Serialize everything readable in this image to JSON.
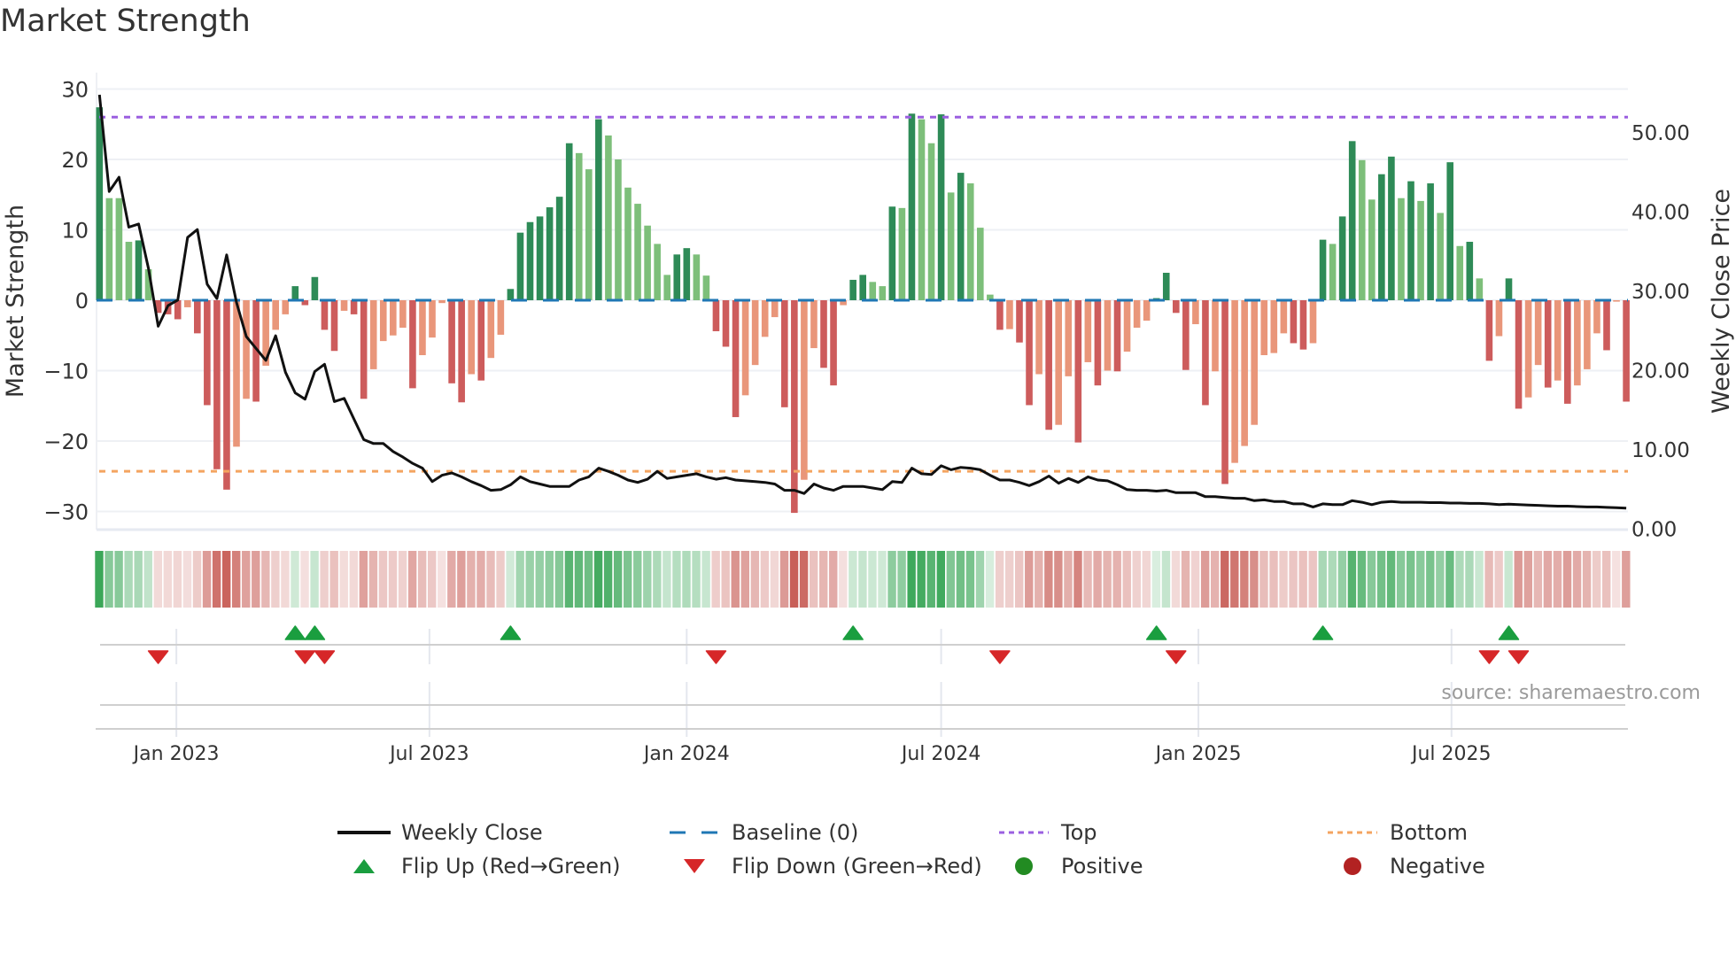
{
  "title": "Market Strength",
  "source": "source: sharemaestro.com",
  "legend": {
    "weekly_close": "Weekly Close",
    "baseline": "Baseline (0)",
    "top": "Top",
    "bottom": "Bottom",
    "flip_up": "Flip Up (Red→Green)",
    "flip_down": "Flip Down (Green→Red)",
    "positive": "Positive",
    "negative": "Negative"
  },
  "colors": {
    "bar_pos_strong": "#2e8b57",
    "bar_pos_weak": "#7dbf7a",
    "bar_neg_strong": "#cd5c5c",
    "bar_neg_weak": "#e9967a",
    "baseline": "#1f77b4",
    "top": "#9b5fe0",
    "bottom": "#f4a460",
    "flip_up": "#1a9e3f",
    "flip_down": "#d62728",
    "positive": "#228b22",
    "negative": "#b22222",
    "close": "#111111"
  },
  "chart_data": {
    "type": "bar",
    "title": "Market Strength",
    "ylabel": "Market Strength",
    "y2label": "Weekly Close Price",
    "ylim": [
      -32,
      32
    ],
    "y2lim": [
      0,
      55
    ],
    "yticks": [
      "30",
      "20",
      "10",
      "0",
      "−10",
      "−20",
      "−30"
    ],
    "ytick_values": [
      30,
      20,
      10,
      0,
      -10,
      -20,
      -30
    ],
    "y2ticks": [
      "50.00",
      "40.00",
      "30.00",
      "20.00",
      "10.00",
      "0.00"
    ],
    "y2tick_values": [
      50,
      40,
      30,
      20,
      10,
      0
    ],
    "x_start": "2022-11-07",
    "x_step_days": 7,
    "xticks": [
      {
        "label": "Jan 2023",
        "date": "2023-01-01"
      },
      {
        "label": "Jul 2023",
        "date": "2023-07-01"
      },
      {
        "label": "Jan 2024",
        "date": "2024-01-01"
      },
      {
        "label": "Jul 2024",
        "date": "2024-07-01"
      },
      {
        "label": "Jan 2025",
        "date": "2025-01-01"
      },
      {
        "label": "Jul 2025",
        "date": "2025-07-01"
      }
    ],
    "top_level": 26,
    "bottom_level": -24.3,
    "baseline": 0,
    "strength": [
      27.4,
      14.5,
      14.5,
      8.3,
      8.5,
      4.4,
      -1.8,
      -2,
      -2.7,
      -1,
      -4.7,
      -14.9,
      -24,
      -26.9,
      -20.8,
      -14,
      -14.4,
      -9.3,
      -4.2,
      -2,
      2.0,
      -0.7,
      3.3,
      -4.2,
      -7.2,
      -1.5,
      -2,
      -14,
      -9.8,
      -5.8,
      -5,
      -3.9,
      -12.5,
      -7.8,
      -5.3,
      -0.4,
      -11.8,
      -14.5,
      -10.5,
      -11.4,
      -8.2,
      -4.9,
      1.6,
      9.6,
      11.1,
      11.9,
      13.2,
      14.7,
      22.3,
      20.9,
      18.6,
      25.7,
      23.4,
      20,
      16,
      13.7,
      10.6,
      8,
      3.6,
      6.5,
      7.4,
      6.5,
      3.5,
      -4.4,
      -6.6,
      -16.6,
      -13.5,
      -9.2,
      -5.2,
      -2.4,
      -15.2,
      -30.2,
      -25.5,
      -6.8,
      -9.6,
      -12.1,
      -0.7,
      2.9,
      3.6,
      2.6,
      2.0,
      13.3,
      13.1,
      26.5,
      25.7,
      22.3,
      26.4,
      15.3,
      18.1,
      16.6,
      10.3,
      0.8,
      -4.2,
      -4.1,
      -6,
      -14.9,
      -10.5,
      -18.4,
      -17.7,
      -10.8,
      -20.2,
      -8.8,
      -12.1,
      -10,
      -10.1,
      -7.3,
      -3.9,
      -2.9,
      0.3,
      3.9,
      -1.8,
      -9.9,
      -3.4,
      -14.9,
      -10.1,
      -26.1,
      -23.1,
      -20.7,
      -17.7,
      -7.8,
      -7.5,
      -4.7,
      -6.1,
      -7,
      -6.1,
      8.6,
      8,
      11.9,
      22.6,
      19.9,
      14.3,
      17.9,
      20.4,
      14.5,
      16.9,
      14.1,
      16.6,
      12.4,
      19.6,
      7.7,
      8.3,
      3.1,
      -8.6,
      -5.1,
      3.1,
      -15.4,
      -13.8,
      -9.2,
      -12.4,
      -11.4,
      -14.7,
      -12.1,
      -9.8,
      -4.7,
      -7.1,
      -0.2,
      -14.4
    ],
    "weekly_close": [
      54.8,
      42.6,
      44.4,
      38.1,
      38.5,
      32.9,
      25.6,
      28.2,
      28.9,
      36.8,
      37.8,
      30.9,
      29.1,
      34.6,
      28.6,
      24.3,
      22.8,
      21.3,
      24.4,
      19.8,
      17.2,
      16.4,
      19.9,
      20.8,
      16.1,
      16.5,
      13.9,
      11.3,
      10.8,
      10.8,
      9.8,
      9.1,
      8.3,
      7.7,
      6.0,
      6.8,
      7.1,
      6.6,
      6.0,
      5.5,
      4.9,
      5.0,
      5.6,
      6.6,
      6.0,
      5.7,
      5.4,
      5.4,
      5.4,
      6.2,
      6.6,
      7.7,
      7.3,
      6.8,
      6.2,
      5.9,
      6.3,
      7.3,
      6.4,
      6.6,
      6.8,
      7.0,
      6.6,
      6.3,
      6.5,
      6.2,
      6.1,
      6.0,
      5.9,
      5.7,
      4.9,
      4.9,
      4.5,
      5.7,
      5.2,
      4.9,
      5.4,
      5.4,
      5.4,
      5.2,
      5.0,
      6.0,
      5.9,
      7.7,
      7.0,
      6.9,
      8.0,
      7.5,
      7.8,
      7.7,
      7.5,
      6.8,
      6.2,
      6.2,
      5.9,
      5.5,
      6.0,
      6.7,
      5.8,
      6.4,
      5.9,
      6.6,
      6.2,
      6.1,
      5.6,
      5.0,
      4.9,
      4.9,
      4.8,
      4.9,
      4.6,
      4.6,
      4.6,
      4.1,
      4.1,
      4.0,
      3.9,
      3.9,
      3.6,
      3.7,
      3.5,
      3.5,
      3.2,
      3.2,
      2.8,
      3.2,
      3.1,
      3.1,
      3.6,
      3.4,
      3.1,
      3.4,
      3.5,
      3.4,
      3.4,
      3.4,
      3.35,
      3.35,
      3.3,
      3.3,
      3.25,
      3.25,
      3.2,
      3.1,
      3.15,
      3.1,
      3.05,
      3.0,
      2.95,
      2.9,
      2.9,
      2.85,
      2.8,
      2.8,
      2.75,
      2.7,
      2.65
    ],
    "flip_up_weeks": [
      20,
      22,
      42,
      77,
      108,
      125,
      144
    ],
    "flip_down_weeks": [
      6,
      21,
      23,
      63,
      92,
      110,
      142,
      145
    ],
    "grid": true,
    "legend_position": "bottom"
  }
}
